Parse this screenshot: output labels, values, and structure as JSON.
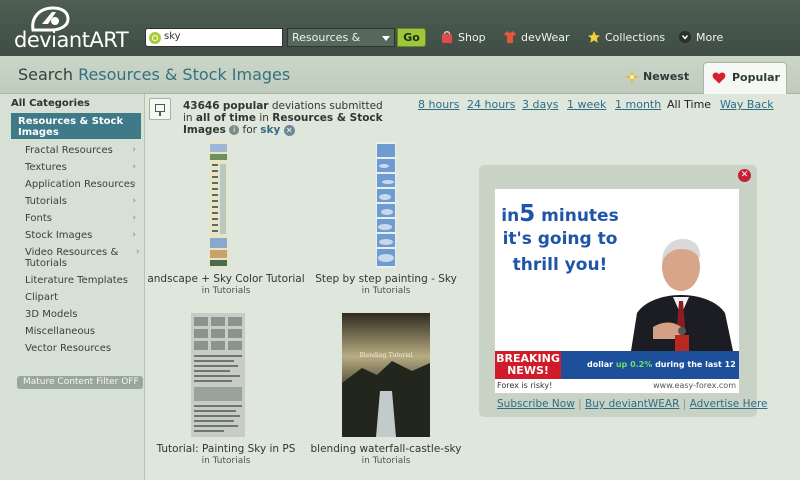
{
  "brand": {
    "name": "deviantART"
  },
  "search": {
    "query": "sky",
    "scope": "Resources &",
    "go_label": "Go"
  },
  "nav": {
    "shop": "Shop",
    "devwear": "devWear",
    "collections": "Collections",
    "more": "More"
  },
  "header": {
    "title_prefix": "Search",
    "title_highlight": "Resources & Stock Images",
    "tabs": {
      "newest": "Newest",
      "popular": "Popular"
    }
  },
  "sidebar": {
    "all_categories": "All Categories",
    "selected": "Resources & Stock Images",
    "items": [
      {
        "label": "Fractal Resources",
        "has_sub": true
      },
      {
        "label": "Textures",
        "has_sub": true
      },
      {
        "label": "Application Resources",
        "has_sub": true
      },
      {
        "label": "Tutorials",
        "has_sub": true
      },
      {
        "label": "Fonts",
        "has_sub": true
      },
      {
        "label": "Stock Images",
        "has_sub": true
      },
      {
        "label": "Video Resources & Tutorials",
        "has_sub": true
      },
      {
        "label": "Literature Templates",
        "has_sub": false
      },
      {
        "label": "Clipart",
        "has_sub": false
      },
      {
        "label": "3D Models",
        "has_sub": false
      },
      {
        "label": "Miscellaneous",
        "has_sub": false
      },
      {
        "label": "Vector Resources",
        "has_sub": false
      }
    ],
    "mature_filter": "Mature Content Filter OFF"
  },
  "results": {
    "count": "43646",
    "popular_word": "popular",
    "text1": "deviations submitted",
    "text2": "in",
    "timeframe": "all of time",
    "text3": "in",
    "category": "Resources & Stock Images",
    "text4": "for",
    "query": "sky"
  },
  "time_filters": [
    "8 hours",
    "24 hours",
    "3 days",
    "1 week",
    "1 month",
    "All Time",
    "Way Back"
  ],
  "time_filters_active": "All Time",
  "thumbnails": [
    {
      "title": "andscape + Sky Color Tutorial",
      "sub": "in Tutorials"
    },
    {
      "title": "Step by step painting - Sky",
      "sub": "in Tutorials"
    },
    {
      "title": "Tutorial: Painting Sky in PS",
      "sub": "in Tutorials"
    },
    {
      "title": "blending waterfall-castle-sky",
      "sub": "in Tutorials"
    }
  ],
  "thumbnail_art_text": "Blending Tutorial",
  "ad": {
    "line1_a": "in",
    "line1_b": "5",
    "line1_c": "minutes",
    "line2": "it's going to",
    "line3": "thrill you!",
    "breaking": "BREAKING NEWS!",
    "ticker_a": "dollar",
    "ticker_b": "up 0.2%",
    "ticker_c": "during the last 12 ho",
    "risk": "Forex is risky!",
    "url": "www.easy-forex.com"
  },
  "ad_links": {
    "subscribe": "Subscribe Now",
    "buy": "Buy deviantWEAR",
    "advertise": "Advertise Here",
    "sep": "|"
  },
  "colors": {
    "topbar": "#46554b",
    "accent_teal": "#3f7a89",
    "go_green": "#9fc73b",
    "link_blue": "#2f6c86",
    "close_red": "#c71f34"
  }
}
